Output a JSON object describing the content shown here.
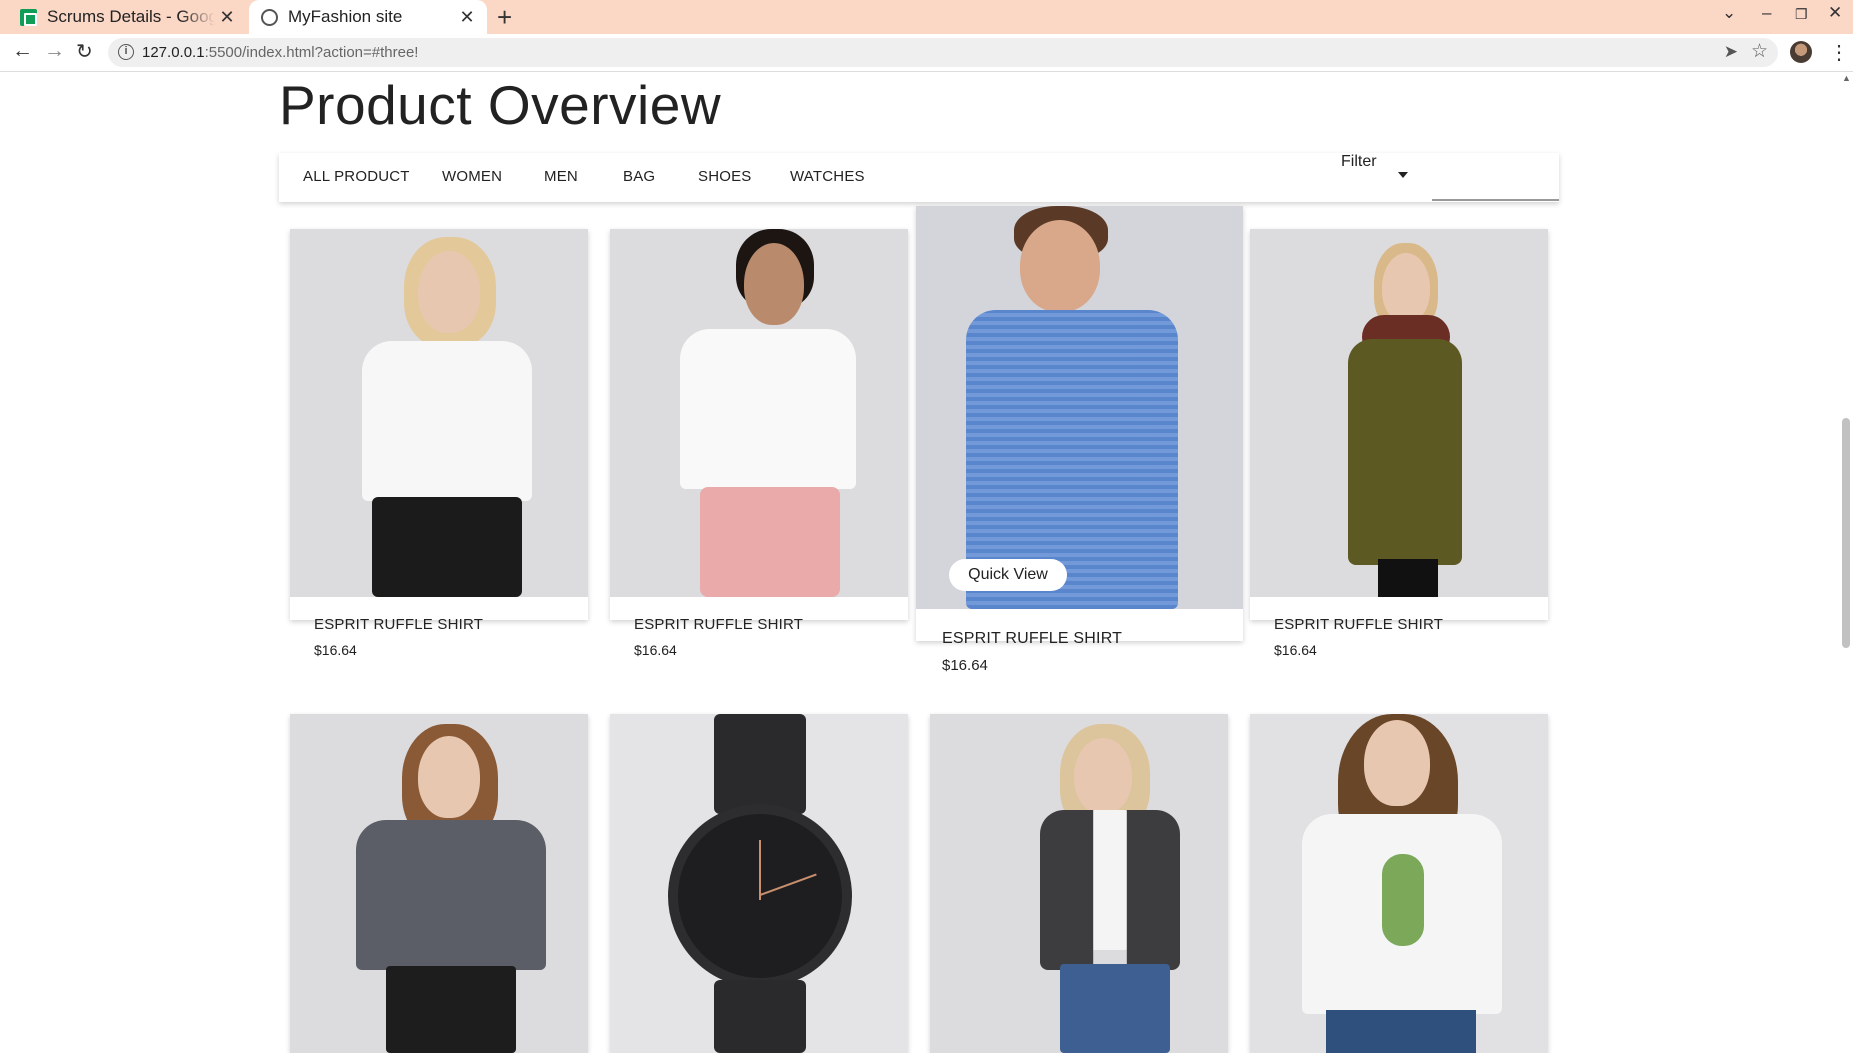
{
  "browser": {
    "tabs": [
      {
        "title": "Scrums Details - Google Sheets",
        "active": false,
        "icon": "sheets-icon"
      },
      {
        "title": "MyFashion site",
        "active": true,
        "icon": "globe-icon"
      }
    ],
    "url_host": "127.0.0.1",
    "url_rest": ":5500/index.html?action=#three!"
  },
  "page": {
    "title": "Product Overview",
    "categories": [
      "ALL PRODUCT",
      "WOMEN",
      "MEN",
      "BAG",
      "SHOES",
      "WATCHES"
    ],
    "filter_label": "Filter"
  },
  "products": [
    {
      "name": "ESPRIT RUFFLE SHIRT",
      "price": "$16.64",
      "image": "woman-white-tshirt"
    },
    {
      "name": "ESPRIT RUFFLE SHIRT",
      "price": "$16.64",
      "image": "woman-white-shirt-pink-pants"
    },
    {
      "name": "ESPRIT RUFFLE SHIRT",
      "price": "$16.64",
      "image": "man-blue-check-shirt",
      "hovered": true,
      "quick_view": "Quick View"
    },
    {
      "name": "ESPRIT RUFFLE SHIRT",
      "price": "$16.64",
      "image": "woman-olive-coat"
    },
    {
      "image": "woman-grey-shirt-black-skirt"
    },
    {
      "image": "black-watch"
    },
    {
      "image": "woman-dark-blazer-jeans"
    },
    {
      "image": "woman-cactus-tshirt"
    }
  ],
  "colors": {
    "tabbar": "#fbd7c6",
    "image_bg": "#dcdcdf",
    "sheets": "#0f9d58"
  }
}
